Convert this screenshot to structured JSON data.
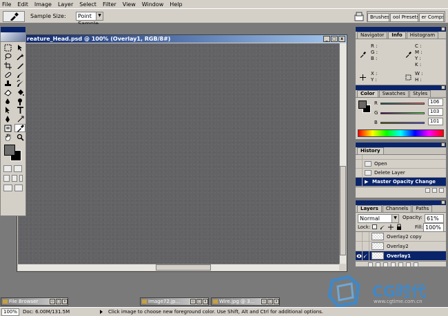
{
  "menu": [
    "File",
    "Edit",
    "Image",
    "Layer",
    "Select",
    "Filter",
    "View",
    "Window",
    "Help"
  ],
  "options_bar": {
    "sample_size_label": "Sample Size:",
    "sample_size_value": "Point Sample",
    "palette_well_tabs": [
      "Brushes",
      "ool Presets",
      "er Comps"
    ]
  },
  "document": {
    "title": "reature_Head.psd @ 100% (Overlay1, RGB/8#)",
    "canvas_color": "#636265"
  },
  "toolbox": {
    "foreground_color": "#6e6e6e",
    "background_color": "#000000"
  },
  "navigator_panel": {
    "tabs": [
      "Navigator",
      "Info",
      "Histogram"
    ],
    "active_tab": "Info",
    "labels": {
      "r": "R :",
      "g": "G :",
      "b": "B :",
      "c": "C :",
      "m": "M :",
      "y": "Y :",
      "k": "K :",
      "x": "X :",
      "yy": "Y :",
      "w": "W :",
      "h": "H :"
    }
  },
  "color_panel": {
    "tabs": [
      "Color",
      "Swatches",
      "Styles"
    ],
    "active_tab": "Color",
    "r_label": "R",
    "g_label": "G",
    "b_label": "B",
    "r": "106",
    "g": "103",
    "b": "101"
  },
  "history_panel": {
    "tabs": [
      "History"
    ],
    "items": [
      "Open",
      "Delete Layer",
      "Master Opacity Change"
    ],
    "selected": "Master Opacity Change"
  },
  "layers_panel": {
    "tabs": [
      "Layers",
      "Channels",
      "Paths"
    ],
    "blend_mode": "Normal",
    "opacity_label": "Opacity:",
    "opacity": "61%",
    "lock_label": "Lock:",
    "fill_label": "Fill:",
    "fill": "100%",
    "layers": [
      "Overlay2 copy",
      "Overlay2",
      "Overlay1"
    ],
    "selected": "Overlay1"
  },
  "minimized_windows": [
    "File Browser",
    "Image72.jp...",
    "Wire.jpg @ 3..."
  ],
  "status_bar": {
    "zoom": "100%",
    "doc": "Doc: 6.00M/131.5M",
    "hint": "Click image to choose new foreground color.  Use Shift, Alt and Ctrl for additional options."
  },
  "watermark": {
    "brand": "CG时代",
    "url": "www.cgtime.com.cn"
  }
}
